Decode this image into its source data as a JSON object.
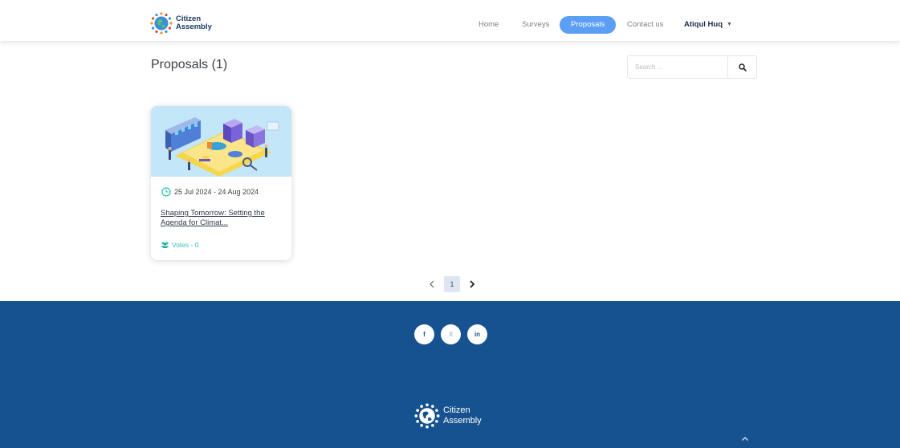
{
  "brand": {
    "line1": "Citizen",
    "line2": "Assembly"
  },
  "nav": {
    "items": [
      {
        "label": "Home"
      },
      {
        "label": "Surveys"
      },
      {
        "label": "Proposals"
      },
      {
        "label": "Contact us"
      }
    ],
    "active": "Proposals",
    "user": "Atiqul Huq"
  },
  "page": {
    "title": "Proposals (1)"
  },
  "search": {
    "placeholder": "Search ..."
  },
  "proposals": [
    {
      "date_range": "25 Jul 2024 - 24 Aug 2024",
      "title": "Shaping Tomorrow: Setting the Agenda for Climat...",
      "votes": "Votes - 0"
    }
  ],
  "pagination": {
    "current": "1"
  },
  "footer": {
    "social": [
      {
        "icon": "facebook-icon",
        "glyph": "f"
      },
      {
        "icon": "x-icon",
        "glyph": "X"
      },
      {
        "icon": "linkedin-icon",
        "glyph": "in"
      }
    ],
    "brand": {
      "line1": "Citizen",
      "line2": "Assembly"
    }
  },
  "colors": {
    "accent": "#5b9ff5",
    "footer": "#16528f",
    "teal": "#3bc3b5"
  }
}
